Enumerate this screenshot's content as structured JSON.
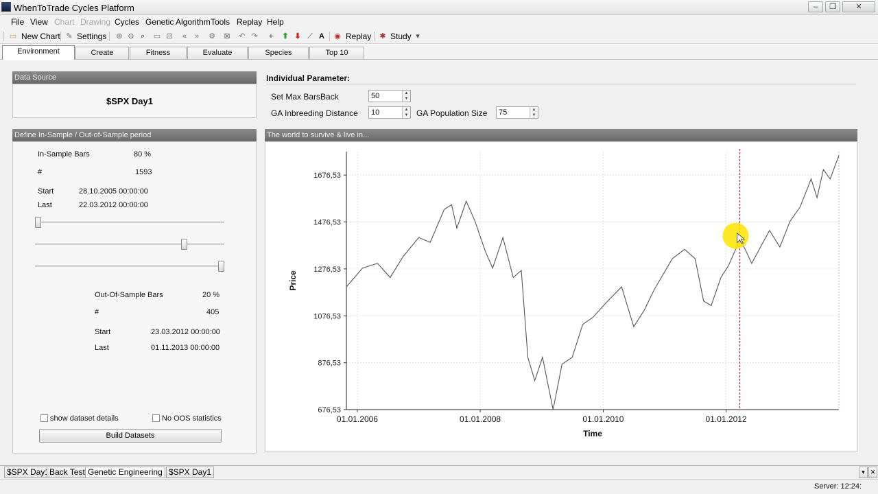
{
  "window": {
    "title": "WhenToTrade Cycles Platform"
  },
  "menu": [
    "File",
    "View",
    "Chart",
    "Drawing",
    "Cycles",
    "Genetic Algorithm",
    "Tools",
    "Replay",
    "Help"
  ],
  "menu_disabled": [
    "Chart",
    "Drawing"
  ],
  "toolbar": {
    "new_chart": "New Chart",
    "settings": "Settings",
    "replay": "Replay",
    "study": "Study"
  },
  "top_tabs": [
    "Environment",
    "Create",
    "Fitness",
    "Evaluate",
    "Species",
    "Top 10"
  ],
  "active_top_tab": "Environment",
  "data_source": {
    "header": "Data Source",
    "value": "$SPX Day1"
  },
  "period": {
    "header": "Define In-Sample / Out-of-Sample period",
    "in_sample_label": "In-Sample Bars",
    "in_sample_pct": "80 %",
    "in_hash_label": "#",
    "in_count": "1593",
    "in_start_label": "Start",
    "in_start": "28.10.2005 00:00:00",
    "in_last_label": "Last",
    "in_last": "22.03.2012 00:00:00",
    "oos_label": "Out-Of-Sample Bars",
    "oos_pct": "20 %",
    "oos_hash_label": "#",
    "oos_count": "405",
    "oos_start_label": "Start",
    "oos_start": "23.03.2012 00:00:00",
    "oos_last_label": "Last",
    "oos_last": "01.11.2013 00:00:00",
    "show_details": "show dataset details",
    "no_oos_stats": "No OOS statistics",
    "build_button": "Build Datasets"
  },
  "params": {
    "header": "Individual Parameter:",
    "max_bars_label": "Set Max BarsBack",
    "max_bars": "50",
    "inbreeding_label": "GA Inbreeding Distance",
    "inbreeding": "10",
    "population_label": "GA Population Size",
    "population": "75"
  },
  "chart_panel_header": "The world to survive & live in...",
  "chart_data": {
    "type": "line",
    "title": "",
    "xlabel": "Time",
    "ylabel": "Price",
    "x_ticks": [
      "01.01.2006",
      "01.01.2008",
      "01.01.2010",
      "01.01.2012"
    ],
    "y_ticks": [
      "676,53",
      "876,53",
      "1076,53",
      "1276,53",
      "1476,53",
      "1676,53"
    ],
    "ylim": [
      676.53,
      1776.53
    ],
    "xlim": [
      "2005-10-28",
      "2013-11-01"
    ],
    "split_date": "2012-03-22",
    "grid": true,
    "series": [
      {
        "x": [
          "2005-10-28",
          "2006-02-01",
          "2006-05-01",
          "2006-07-15",
          "2006-10-01",
          "2007-01-01",
          "2007-03-10",
          "2007-06-01",
          "2007-07-15",
          "2007-08-15",
          "2007-10-10",
          "2007-12-01",
          "2008-02-01",
          "2008-03-15",
          "2008-05-15",
          "2008-07-15",
          "2008-09-01",
          "2008-10-10",
          "2008-11-20",
          "2009-01-05",
          "2009-03-09",
          "2009-05-01",
          "2009-07-01",
          "2009-09-01",
          "2009-11-01",
          "2010-01-15",
          "2010-04-20",
          "2010-07-01",
          "2010-09-01",
          "2010-11-01",
          "2011-02-15",
          "2011-04-29",
          "2011-07-01",
          "2011-08-20",
          "2011-10-04",
          "2011-12-01",
          "2012-01-15",
          "2012-03-22",
          "2012-04-10",
          "2012-06-01",
          "2012-08-15",
          "2012-09-15",
          "2012-11-15",
          "2013-01-15",
          "2013-03-15",
          "2013-05-20",
          "2013-06-24",
          "2013-08-01",
          "2013-09-10",
          "2013-11-01"
        ],
        "y": [
          1200,
          1280,
          1300,
          1240,
          1330,
          1410,
          1390,
          1530,
          1550,
          1450,
          1565,
          1480,
          1350,
          1280,
          1410,
          1240,
          1270,
          900,
          800,
          900,
          676,
          870,
          900,
          1040,
          1070,
          1130,
          1200,
          1030,
          1100,
          1190,
          1320,
          1360,
          1320,
          1140,
          1120,
          1240,
          1290,
          1400,
          1380,
          1300,
          1400,
          1440,
          1370,
          1480,
          1540,
          1660,
          1580,
          1700,
          1660,
          1760
        ]
      }
    ]
  }
}
